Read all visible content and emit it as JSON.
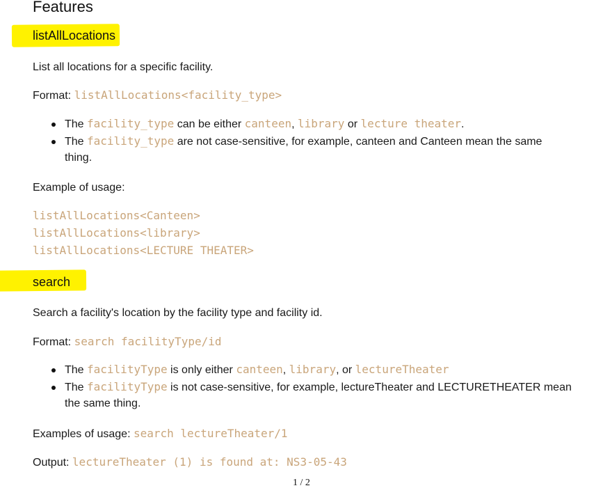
{
  "features_heading": "Features",
  "sec1": {
    "title": "listAllLocations",
    "desc": "List all locations for a specific facility.",
    "format_label": "Format: ",
    "format_code": "listAllLocations<facility_type>",
    "bullet1": {
      "the": "The ",
      "code1": "facility_type",
      "t1": " can be either ",
      "code2": "canteen",
      "t2": ", ",
      "code3": "library",
      "t3": " or ",
      "code4": "lecture theater",
      "t4": "."
    },
    "bullet2": {
      "the": "The ",
      "code1": "facility_type",
      "t1": " are not case-sensitive, for example, canteen and Canteen mean the same",
      "t2": "thing."
    },
    "usage_label": "Example of usage:",
    "examples": [
      "listAllLocations<Canteen>",
      "listAllLocations<library>",
      "listAllLocations<LECTURE THEATER>"
    ]
  },
  "sec2": {
    "title": "search",
    "desc": "Search a facility's location by the facility type and facility id.",
    "format_label": "Format: ",
    "format_code": "search facilityType/id",
    "bullet1": {
      "the": "The ",
      "code1": "facilityType",
      "t1": " is only either ",
      "code2": "canteen",
      "t2": ", ",
      "code3": "library",
      "t3": ", or ",
      "code4": "lectureTheater"
    },
    "bullet2": {
      "the": "The ",
      "code1": "facilityType",
      "t1": " is not case-sensitive, for example, lectureTheater and LECTURETHEATER mean",
      "t2": "the same thing."
    },
    "usage_label": "Examples of usage: ",
    "usage_code": "search lectureTheater/1",
    "output_label": "Output: ",
    "output_code": "lectureTheater (1) is found at: NS3-05-43"
  },
  "page_number": "1 / 2",
  "colors": {
    "highlight": "#fff200",
    "code": "#c9a57a",
    "text": "#1a1a1a"
  }
}
